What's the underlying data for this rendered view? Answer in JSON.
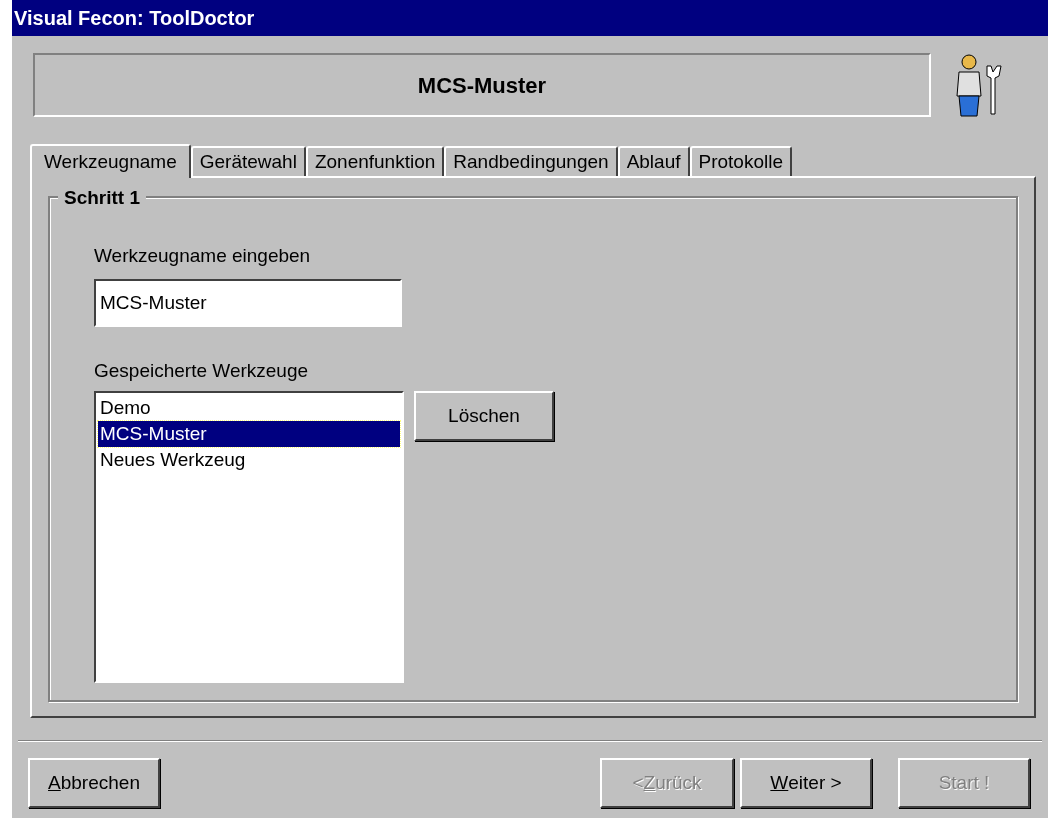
{
  "window": {
    "title": "Visual Fecon: ToolDoctor"
  },
  "header": {
    "title": "MCS-Muster"
  },
  "tabs": [
    {
      "label": "Werkzeugname",
      "selected": true
    },
    {
      "label": "Gerätewahl",
      "selected": false
    },
    {
      "label": "Zonenfunktion",
      "selected": false
    },
    {
      "label": "Randbedingungen",
      "selected": false
    },
    {
      "label": "Ablauf",
      "selected": false
    },
    {
      "label": "Protokolle",
      "selected": false
    }
  ],
  "group": {
    "title": "Schritt 1"
  },
  "name_field": {
    "label": "Werkzeugname eingeben",
    "value": "MCS-Muster"
  },
  "saved_list": {
    "label": "Gespeicherte Werkzeuge",
    "items": [
      {
        "label": "Demo",
        "selected": false
      },
      {
        "label": "MCS-Muster",
        "selected": true
      },
      {
        "label": "Neues Werkzeug",
        "selected": false
      }
    ]
  },
  "delete_button": {
    "label": "Löschen",
    "disabled": false
  },
  "buttons": [
    {
      "mnemonic": "A",
      "rest": "bbrechen",
      "disabled": false
    },
    {
      "prefix": "< ",
      "mnemonic": "Z",
      "rest": "urück",
      "disabled": true
    },
    {
      "mnemonic": "W",
      "rest": "eiter >",
      "disabled": false
    },
    {
      "rest": "Start !",
      "disabled": true
    }
  ]
}
